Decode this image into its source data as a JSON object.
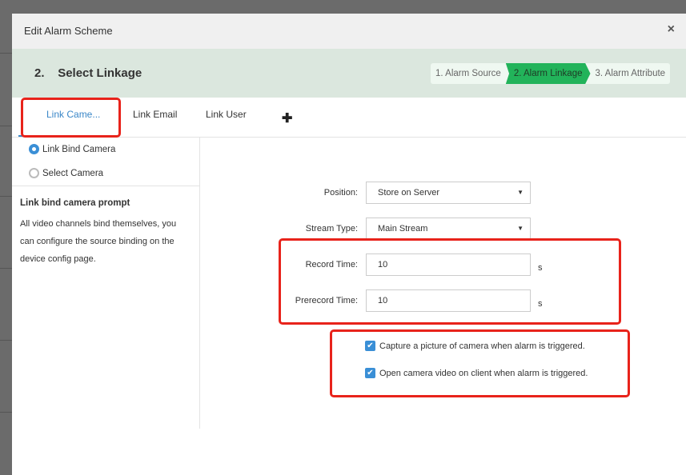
{
  "dialog": {
    "title": "Edit Alarm Scheme",
    "close": "×"
  },
  "step": {
    "number": "2.",
    "title": "Select Linkage",
    "steps": [
      {
        "label": "1. Alarm Source"
      },
      {
        "label": "2. Alarm Linkage",
        "active": true
      },
      {
        "label": "3. Alarm Attribute"
      }
    ]
  },
  "tabs": [
    {
      "label": "Link Came...",
      "active": true
    },
    {
      "label": "Link Email"
    },
    {
      "label": "Link User"
    }
  ],
  "add_tab": "✚",
  "camera_mode": {
    "options": [
      {
        "label": "Link Bind Camera",
        "selected": true
      },
      {
        "label": "Select Camera",
        "selected": false
      }
    ]
  },
  "prompt": {
    "title": "Link bind camera prompt",
    "text": "All video channels bind themselves, you can configure the source binding on the device config page."
  },
  "form": {
    "position": {
      "label": "Position:",
      "value": "Store on Server"
    },
    "stream_type": {
      "label": "Stream Type:",
      "value": "Main Stream"
    },
    "record_time": {
      "label": "Record Time:",
      "value": "10",
      "unit": "s"
    },
    "prerecord_time": {
      "label": "Prerecord Time:",
      "value": "10",
      "unit": "s"
    },
    "capture": {
      "label": "Capture a picture of camera when alarm is triggered.",
      "checked": true
    },
    "open_video": {
      "label": "Open camera video on client when alarm is triggered.",
      "checked": true
    }
  },
  "colors": {
    "accent": "#3a87c8",
    "step_active": "#22b35a",
    "highlight": "#e8231b",
    "band": "#dbe7de"
  }
}
